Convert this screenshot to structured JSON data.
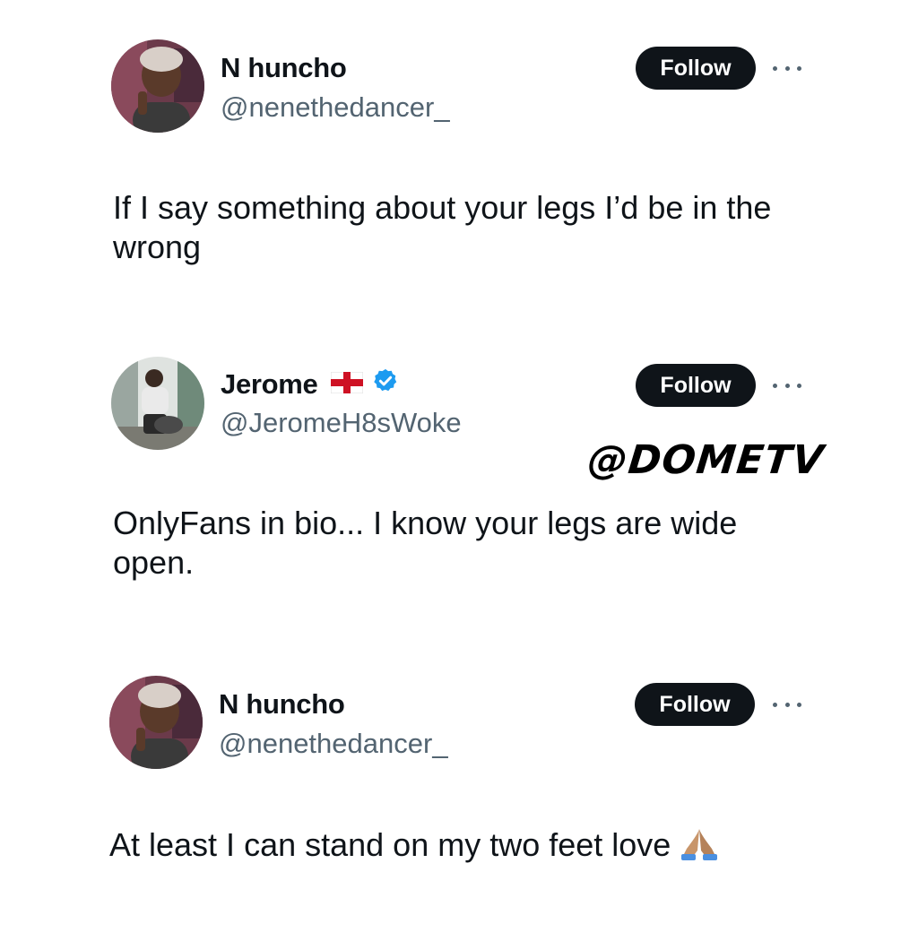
{
  "tweets": [
    {
      "name": "N huncho",
      "handle": "@nenethedancer_",
      "follow_label": "Follow",
      "text": "If I say something about your legs I’d be in the wrong",
      "avatar_icon": "avatar-photo-woman"
    },
    {
      "name": "Jerome",
      "handle": "@JeromeH8sWoke",
      "follow_label": "Follow",
      "text": "OnlyFans in bio... I know your legs are wide open.",
      "flag_icon": "england-flag-icon",
      "verified_icon": "verified-badge-icon",
      "avatar_icon": "avatar-photo-man-with-dog"
    },
    {
      "name": "N huncho",
      "handle": "@nenethedancer_",
      "follow_label": "Follow",
      "text": "At least I can stand on my two feet love",
      "emoji_icon": "folded-hands-emoji",
      "avatar_icon": "avatar-photo-woman"
    }
  ],
  "watermark": "@DOMETV",
  "colors": {
    "text": "#0f1419",
    "handle": "#536471",
    "button": "#0f1419",
    "verified": "#1d9bf0"
  }
}
